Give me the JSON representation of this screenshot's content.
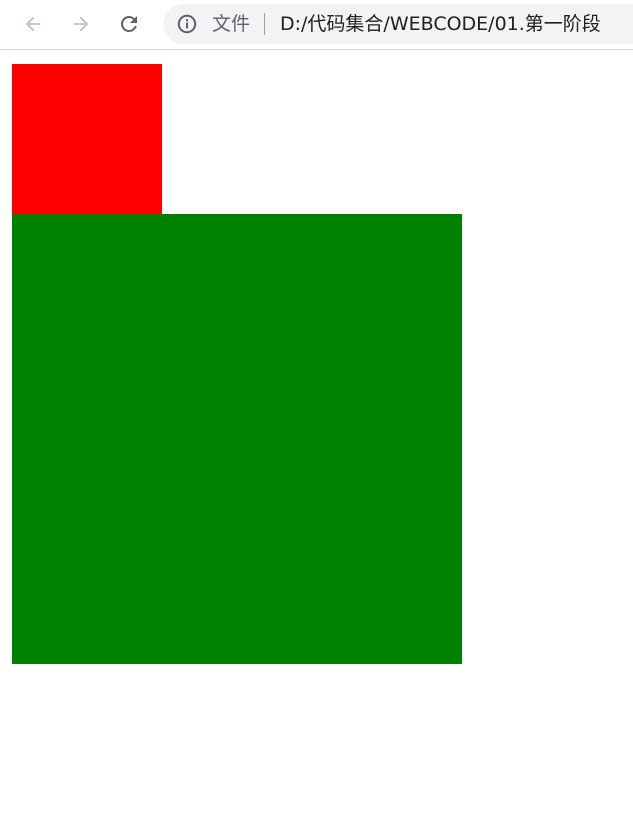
{
  "browser": {
    "icons": {
      "back": "arrow-left-icon",
      "forward": "arrow-right-icon",
      "reload": "reload-icon",
      "info": "info-icon"
    },
    "address_bar": {
      "scheme_label": "文件",
      "url": "D:/代码集合/WEBCODE/01.第一阶段"
    }
  },
  "page": {
    "boxes": [
      {
        "name": "red-box",
        "color": "#ff0000"
      },
      {
        "name": "green-box",
        "color": "#008000"
      }
    ]
  }
}
